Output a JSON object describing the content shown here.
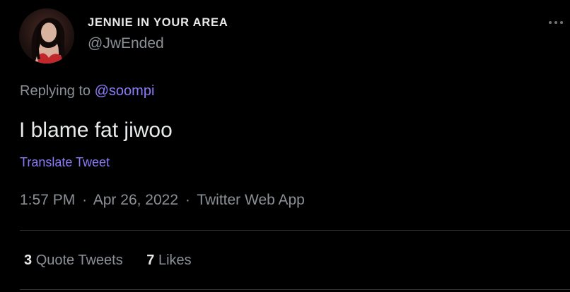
{
  "author": {
    "display_name": "JENNIE IN YOUR AREA",
    "handle": "@JwEnded",
    "avatar_icon": "profile-photo"
  },
  "more_icon": "more-horizontal-icon",
  "reply_context": {
    "prefix": "Replying to",
    "mention": "@soompi"
  },
  "tweet": {
    "text": "I blame fat jiwoo",
    "translate_label": "Translate Tweet"
  },
  "meta": {
    "time": "1:57 PM",
    "separator": "·",
    "date": "Apr 26, 2022",
    "source": "Twitter Web App"
  },
  "stats": {
    "quote_tweets_count": "3",
    "quote_tweets_label": "Quote Tweets",
    "likes_count": "7",
    "likes_label": "Likes"
  },
  "colors": {
    "background": "#000000",
    "primary_text": "#e7e9ea",
    "secondary_text": "#8b9096",
    "link": "#8a7cf8",
    "divider": "#2f3336"
  }
}
